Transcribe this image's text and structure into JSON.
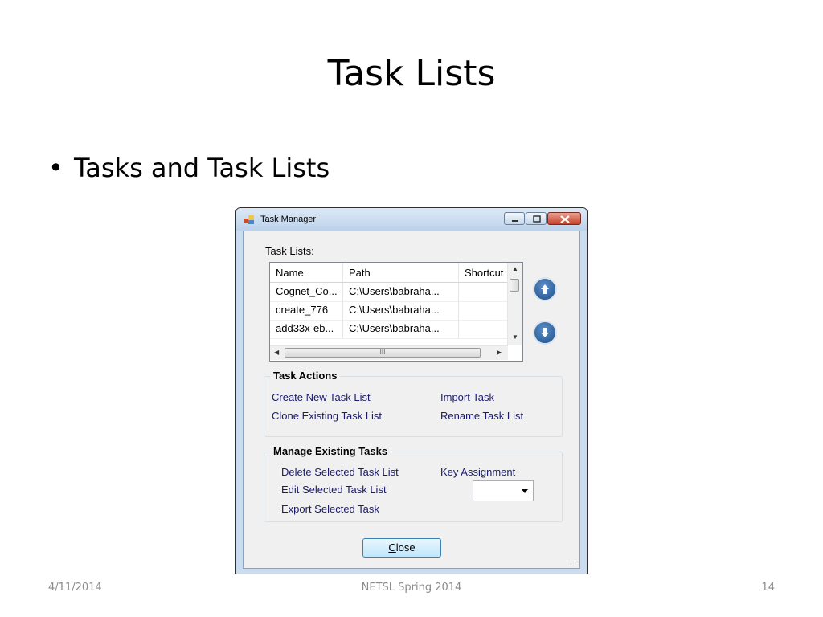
{
  "slide": {
    "title": "Task Lists",
    "bullet": "Tasks and Task Lists",
    "footer_date": "4/11/2014",
    "footer_center": "NETSL Spring 2014",
    "footer_page": "14"
  },
  "window": {
    "title": "Task Manager",
    "task_lists_label": "Task Lists:",
    "columns": [
      "Name",
      "Path",
      "Shortcut"
    ],
    "rows": [
      {
        "name": "Cognet_Co...",
        "path": "C:\\Users\\babraha...",
        "shortcut": ""
      },
      {
        "name": "create_776",
        "path": "C:\\Users\\babraha...",
        "shortcut": ""
      },
      {
        "name": "add33x-eb...",
        "path": "C:\\Users\\babraha...",
        "shortcut": ""
      }
    ],
    "hscroll_grip": "III",
    "task_actions": {
      "title": "Task Actions",
      "create": "Create New Task List",
      "clone": "Clone Existing Task List",
      "import": "Import Task",
      "rename": "Rename Task List"
    },
    "manage": {
      "title": "Manage Existing Tasks",
      "delete": "Delete Selected Task List",
      "edit": "Edit Selected Task List",
      "export": "Export Selected Task",
      "key_assignment": "Key Assignment",
      "key_value": ""
    },
    "close_accel": "C",
    "close_rest": "lose"
  },
  "colors": {
    "link": "#1a1a6e",
    "window_frame": "#c9dcf0",
    "round_button": "#1f4f8a"
  }
}
